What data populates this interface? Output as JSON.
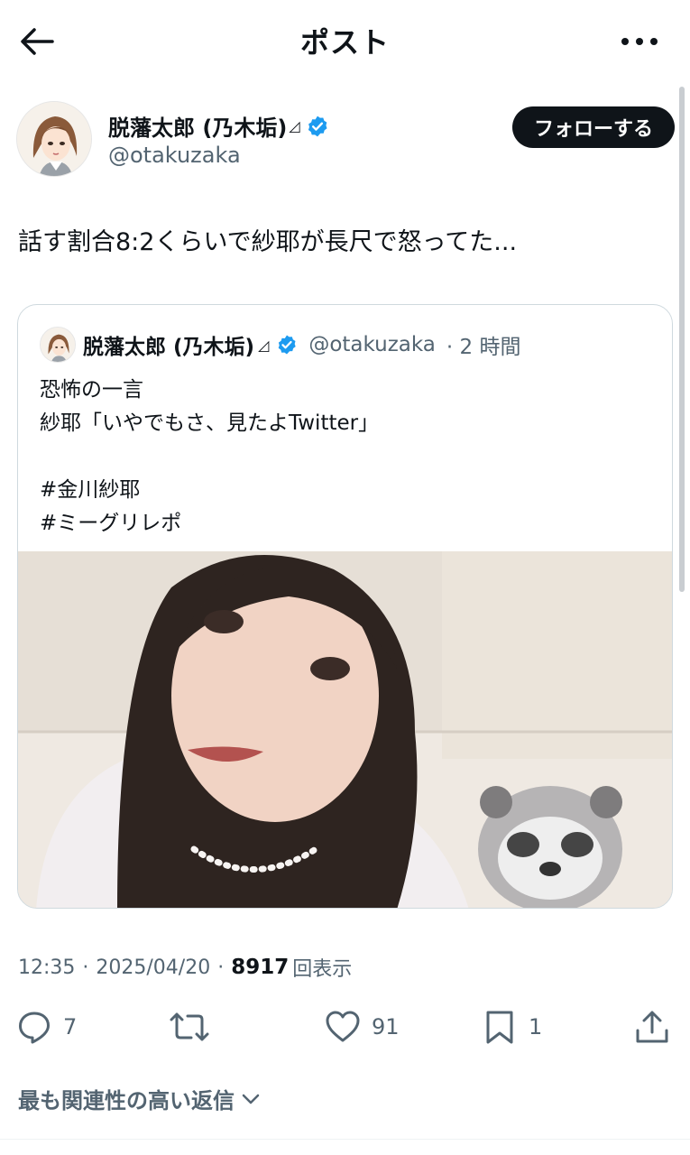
{
  "header": {
    "title": "ポスト"
  },
  "author": {
    "name": "脱藩太郎 (乃木垢)",
    "mark": "◿",
    "handle": "@otakuzaka",
    "follow_label": "フォローする"
  },
  "tweet": {
    "text": "話す割合8:2くらいで紗耶が長尺で怒ってた..."
  },
  "quote": {
    "name": "脱藩太郎 (乃木垢)",
    "mark": "◿",
    "handle": "@otakuzaka",
    "time": "· 2 時間",
    "lines": [
      "恐怖の一言",
      "紗耶「いやでもさ、見たよTwitter」",
      "",
      "#金川紗耶",
      "#ミーグリレポ"
    ]
  },
  "meta": {
    "time": "12:35",
    "sep1": "·",
    "date": "2025/04/20",
    "sep2": "·",
    "views": "8917",
    "views_label": "回表示"
  },
  "actions": {
    "replies": "7",
    "reposts": "",
    "likes": "91",
    "bookmarks": "1"
  },
  "sort": {
    "label": "最も関連性の高い返信"
  },
  "colors": {
    "accent": "#1d9bf0",
    "text": "#0f1419",
    "muted": "#536471"
  },
  "icons": [
    "back-arrow-icon",
    "more-icon",
    "verified-badge-icon",
    "reply-icon",
    "repost-icon",
    "like-icon",
    "bookmark-icon",
    "share-icon",
    "chevron-down-icon"
  ]
}
